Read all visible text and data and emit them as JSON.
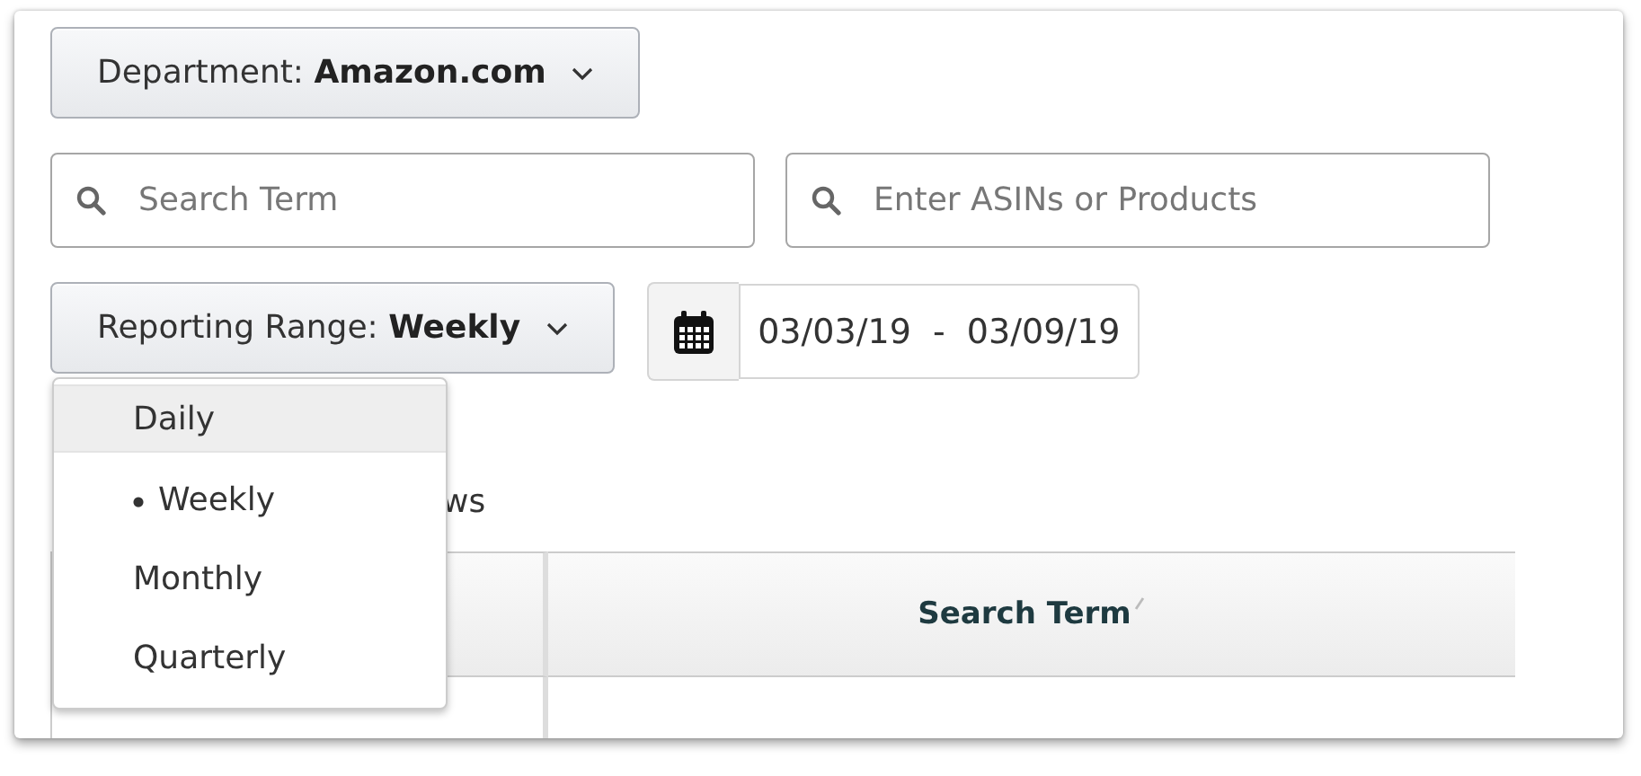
{
  "department": {
    "label": "Department: ",
    "value": "Amazon.com"
  },
  "search_fields": [
    {
      "placeholder": "Search Term"
    },
    {
      "placeholder": "Enter ASINs or Products"
    }
  ],
  "reporting_range": {
    "label": "Reporting Range: ",
    "value": "Weekly",
    "expanded": true,
    "options": [
      {
        "label": "Daily",
        "highlighted": true,
        "selected": false
      },
      {
        "label": "Weekly",
        "highlighted": false,
        "selected": true
      },
      {
        "label": "Monthly",
        "highlighted": false,
        "selected": false
      },
      {
        "label": "Quarterly",
        "highlighted": false,
        "selected": false
      }
    ]
  },
  "date_range": {
    "value": "03/03/19  -  03/09/19"
  },
  "rows_text": "ws",
  "table": {
    "columns": [
      "",
      "Search Term"
    ]
  }
}
